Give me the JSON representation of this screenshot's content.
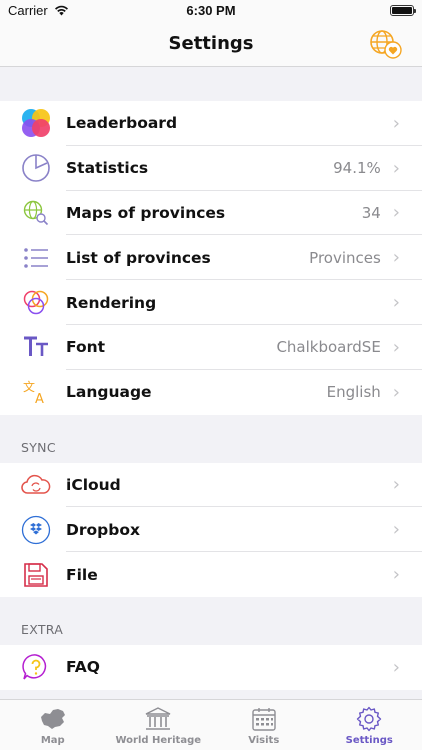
{
  "status_bar": {
    "carrier": "Carrier",
    "time": "6:30 PM"
  },
  "nav": {
    "title": "Settings"
  },
  "main_rows": [
    {
      "label": "Leaderboard",
      "value": ""
    },
    {
      "label": "Statistics",
      "value": "94.1%"
    },
    {
      "label": "Maps of provinces",
      "value": "34"
    },
    {
      "label": "List of provinces",
      "value": "Provinces"
    },
    {
      "label": "Rendering",
      "value": ""
    },
    {
      "label": "Font",
      "value": "ChalkboardSE"
    },
    {
      "label": "Language",
      "value": "English"
    }
  ],
  "sync": {
    "header": "SYNC",
    "rows": [
      {
        "label": "iCloud"
      },
      {
        "label": "Dropbox"
      },
      {
        "label": "File"
      }
    ]
  },
  "extra": {
    "header": "EXTRA",
    "rows": [
      {
        "label": "FAQ"
      }
    ]
  },
  "tabs": [
    {
      "label": "Map",
      "icon": "china-map-icon"
    },
    {
      "label": "World Heritage",
      "icon": "temple-icon"
    },
    {
      "label": "Visits",
      "icon": "calendar-icon"
    },
    {
      "label": "Settings",
      "icon": "gear-icon",
      "active": true
    }
  ],
  "colors": {
    "accent": "#6a58c5",
    "orange": "#f5a623",
    "chevron": "#c4c4c7"
  }
}
